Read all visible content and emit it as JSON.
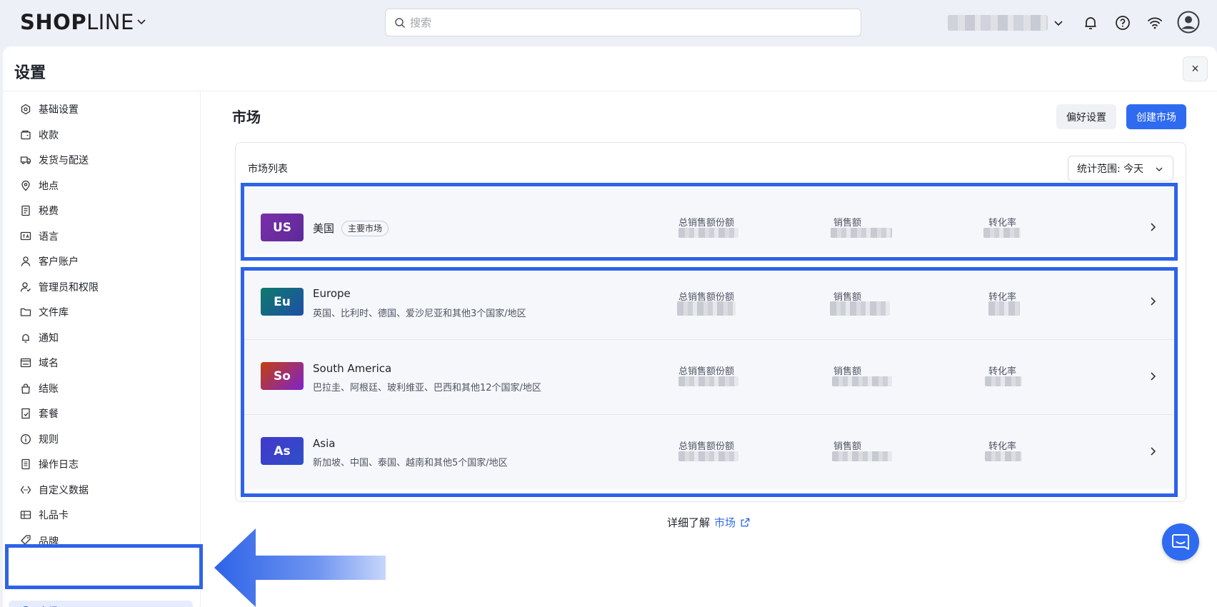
{
  "topbar": {
    "logo_bold": "SH",
    "logo_o": "O",
    "logo_p": "P",
    "logo_light": "LINE",
    "search_placeholder": "搜索"
  },
  "panel": {
    "title": "设置",
    "close_label": "×"
  },
  "sidebar": {
    "items": [
      {
        "label": "基础设置",
        "icon": "gear-icon"
      },
      {
        "label": "收款",
        "icon": "wallet-icon"
      },
      {
        "label": "发货与配送",
        "icon": "truck-icon"
      },
      {
        "label": "地点",
        "icon": "location-pin-icon"
      },
      {
        "label": "税费",
        "icon": "receipt-icon"
      },
      {
        "label": "语言",
        "icon": "language-icon"
      },
      {
        "label": "客户账户",
        "icon": "user-icon"
      },
      {
        "label": "管理员和权限",
        "icon": "admin-icon"
      },
      {
        "label": "文件库",
        "icon": "folder-icon"
      },
      {
        "label": "通知",
        "icon": "bell-icon"
      },
      {
        "label": "域名",
        "icon": "domain-icon"
      },
      {
        "label": "结账",
        "icon": "bag-icon"
      },
      {
        "label": "套餐",
        "icon": "plan-icon"
      },
      {
        "label": "规则",
        "icon": "info-icon"
      },
      {
        "label": "操作日志",
        "icon": "log-icon"
      },
      {
        "label": "自定义数据",
        "icon": "code-icon"
      },
      {
        "label": "礼品卡",
        "icon": "gift-card-icon"
      },
      {
        "label": "品牌",
        "icon": "brand-icon"
      },
      {
        "label": "市场",
        "icon": "globe-icon",
        "active": true
      }
    ]
  },
  "main": {
    "title": "市场",
    "pref_button": "偏好设置",
    "create_button": "创建市场",
    "card_title": "市场列表",
    "range_label": "统计范围: 今天",
    "metric_labels": [
      "总销售额份额",
      "销售额",
      "转化率"
    ],
    "markets": [
      {
        "code": "US",
        "name": "美国",
        "tag": "主要市场",
        "desc": "",
        "color_from": "#7b2fa8",
        "color_to": "#5d2a9a"
      },
      {
        "code": "Eu",
        "name": "Europe",
        "tag": "",
        "desc": "英国、比利时、德国、爱沙尼亚和其他3个国家/地区",
        "color_from": "#0e7a6a",
        "color_to": "#1f4fa8"
      },
      {
        "code": "So",
        "name": "South America",
        "tag": "",
        "desc": "巴拉圭、阿根廷、玻利维亚、巴西和其他12个国家/地区",
        "color_from": "#c2410c",
        "color_to": "#7e22ce"
      },
      {
        "code": "As",
        "name": "Asia",
        "tag": "",
        "desc": "新加坡、中国、泰国、越南和其他5个国家/地区",
        "color_from": "#4338ca",
        "color_to": "#2f4fc8"
      }
    ],
    "learn_prefix": "详细了解",
    "learn_link": "市场"
  },
  "colors": {
    "accent": "#2f6bf0",
    "highlight": "#2e63e8"
  }
}
